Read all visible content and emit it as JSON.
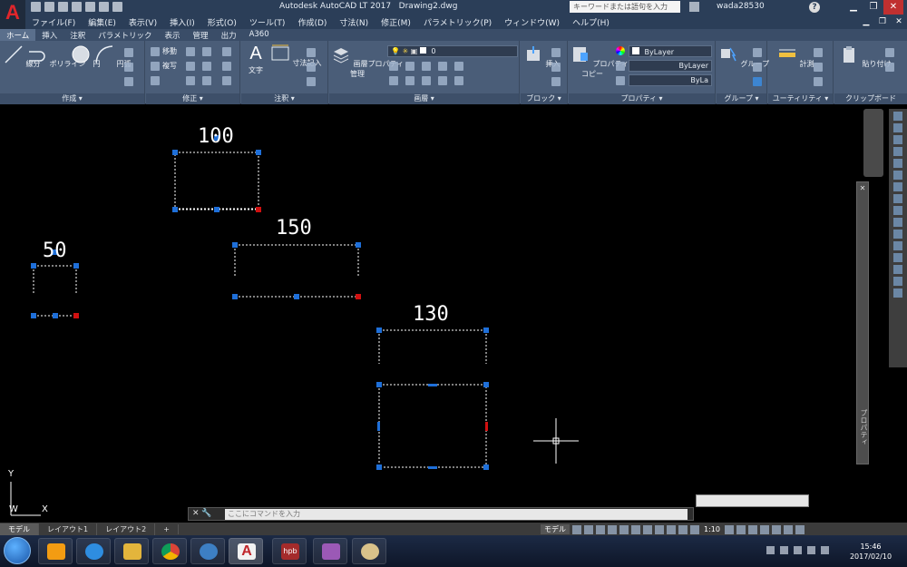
{
  "titlebar": {
    "app": "Autodesk AutoCAD LT 2017",
    "document": "Drawing2.dwg",
    "search_placeholder": "キーワードまたは語句を入力",
    "user": "wada28530",
    "help": "?"
  },
  "menu": [
    "ファイル(F)",
    "編集(E)",
    "表示(V)",
    "挿入(I)",
    "形式(O)",
    "ツール(T)",
    "作成(D)",
    "寸法(N)",
    "修正(M)",
    "パラメトリック(P)",
    "ウィンドウ(W)",
    "ヘルプ(H)"
  ],
  "ribbon_tabs": [
    "ホーム",
    "挿入",
    "注釈",
    "パラメトリック",
    "表示",
    "管理",
    "出力",
    "A360"
  ],
  "ribbon": {
    "draw": {
      "title": "作成 ▾",
      "line": "線分",
      "polyline": "ポリライン",
      "circle": "円",
      "arc": "円弧"
    },
    "modify": {
      "title": "修正 ▾",
      "move": "移動",
      "copy": "複写"
    },
    "annotation": {
      "title": "注釈 ▾",
      "text": "文字",
      "dimension": "寸法記入"
    },
    "layers": {
      "title": "画層 ▾",
      "layer_props_1": "画層プロパティ",
      "layer_props_2": "管理",
      "current_layer": "0"
    },
    "block": {
      "title": "ブロック ▾",
      "insert": "挿入"
    },
    "properties": {
      "title": "プロパティ ▾",
      "match_1": "プロパティ",
      "match_2": "コピー",
      "color": "ByLayer",
      "linetype": "ByLayer",
      "lineweight": "ByLa"
    },
    "groups": {
      "title": "グループ ▾",
      "group": "グループ"
    },
    "utilities": {
      "title": "ユーティリティ ▾",
      "measure": "計測"
    },
    "clipboard": {
      "title": "クリップボード",
      "paste": "貼り付け"
    }
  },
  "canvas": {
    "dims": [
      "100",
      "150",
      "50",
      "130"
    ],
    "ucs_y": "Y",
    "ucs_w": "W",
    "ucs_x": "X"
  },
  "palette": {
    "vertical_label": "プロパティ",
    "close": "✕"
  },
  "command": {
    "placeholder": "ここにコマンドを入力"
  },
  "layout_tabs": [
    "モデル",
    "レイアウト1",
    "レイアウト2",
    "+"
  ],
  "status": {
    "model": "モデル",
    "scale": "1:10"
  },
  "clock": {
    "time": "15:46",
    "date": "2017/02/10"
  },
  "colors": {
    "grip_blue": "#1e6fd9",
    "grip_red": "#d01010",
    "ribbon": "#4a5d78",
    "title": "#2b3e58"
  }
}
